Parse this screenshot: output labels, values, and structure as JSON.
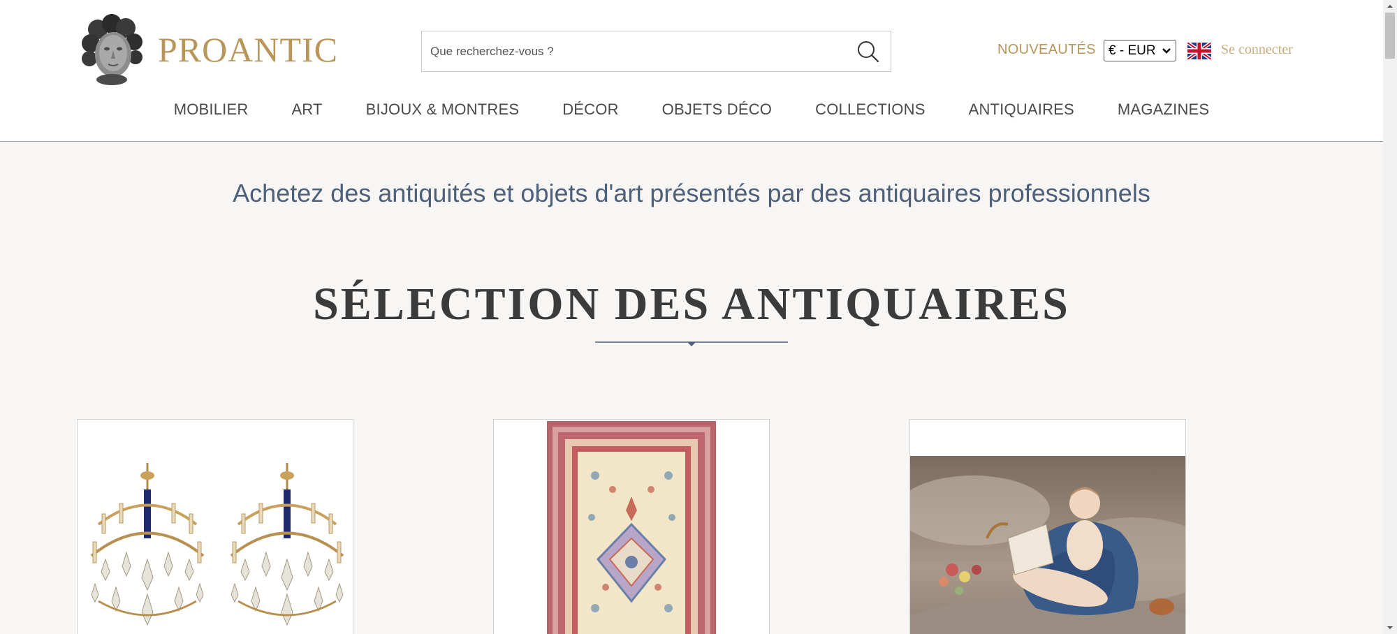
{
  "header": {
    "logo_text": "PROANTIC",
    "search": {
      "placeholder": "Que recherchez-vous ?",
      "value": ""
    },
    "new_link": "NOUVEAUTÉS",
    "currency": "€ - EUR",
    "language_flag": "uk-flag-icon",
    "login": "Se connecter"
  },
  "nav": {
    "items": [
      {
        "label": "MOBILIER"
      },
      {
        "label": "ART"
      },
      {
        "label": "BIJOUX & MONTRES"
      },
      {
        "label": "DÉCOR"
      },
      {
        "label": "OBJETS DÉCO"
      },
      {
        "label": "COLLECTIONS"
      },
      {
        "label": "ANTIQUAIRES"
      },
      {
        "label": "MAGAZINES"
      }
    ]
  },
  "hero": {
    "tagline": "Achetez des antiquités et objets d'art présentés par des antiquaires professionnels",
    "section_title": "SÉLECTION DES ANTIQUAIRES"
  },
  "cards": [
    {
      "image": "pair-of-crystal-chandeliers"
    },
    {
      "image": "persian-rug"
    },
    {
      "image": "rococo-painting-reclining-woman"
    }
  ],
  "colors": {
    "brand_gold": "#b8965a",
    "login_gold": "#c9ad7e",
    "tagline_blue": "#4d6079",
    "page_bg": "#f7f6f4"
  }
}
